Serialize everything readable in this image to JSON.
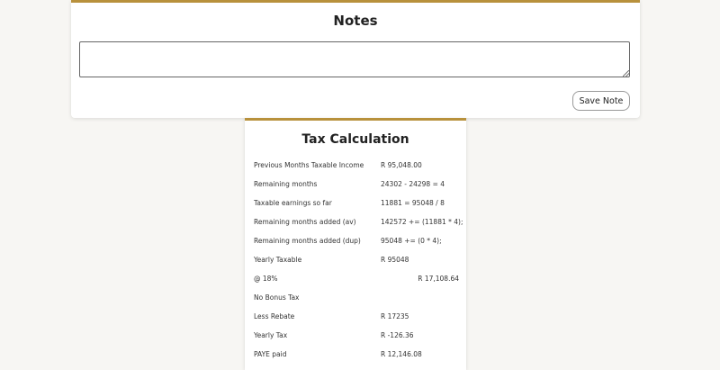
{
  "notes": {
    "title": "Notes",
    "textarea_value": "",
    "save_button": "Save Note"
  },
  "tax": {
    "title": "Tax Calculation",
    "rows": [
      {
        "label": "Previous Months Taxable Income",
        "value": "R 95,048.00"
      },
      {
        "label": "Remaining months",
        "value": "24302 - 24298 = 4"
      },
      {
        "label": "Taxable earnings so far",
        "value": "11881 = 95048 / 8"
      },
      {
        "label": "Remaining months added (av)",
        "value": "142572 += (11881 * 4);"
      },
      {
        "label": "Remaining months added (dup)",
        "value": "95048 += (0 * 4);"
      },
      {
        "label": "Yearly Taxable",
        "value": "R 95048"
      },
      {
        "label": "@ 18%",
        "value": "R 17,108.64"
      },
      {
        "label": "No Bonus Tax",
        "value": ""
      },
      {
        "label": "Less Rebate",
        "value": "R 17235"
      },
      {
        "label": "Yearly Tax",
        "value": "R -126.36"
      },
      {
        "label": "PAYE paid",
        "value": "R 12,146.08"
      }
    ]
  },
  "colors": {
    "accent": "#b8913c",
    "background": "#f7f6f3"
  }
}
